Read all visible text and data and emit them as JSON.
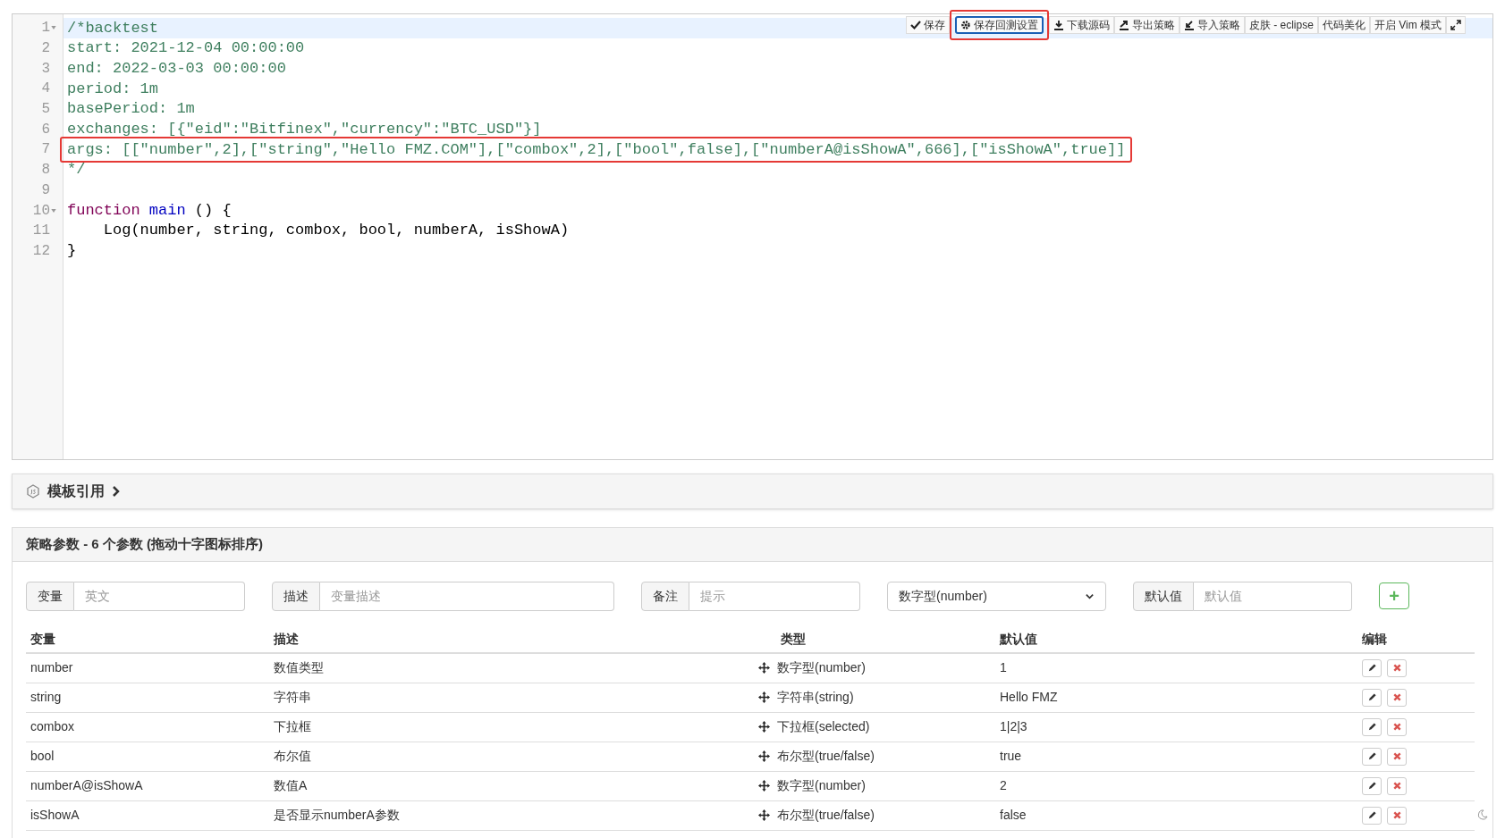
{
  "toolbar": [
    {
      "label": "保存",
      "selected": false,
      "annotated": false
    },
    {
      "label": "保存回测设置",
      "selected": true,
      "annotated": true
    },
    {
      "label": "下载源码",
      "selected": false,
      "annotated": false
    },
    {
      "label": "导出策略",
      "selected": false,
      "annotated": false
    },
    {
      "label": "导入策略",
      "selected": false,
      "annotated": false
    },
    {
      "label": "皮肤 - eclipse",
      "selected": false,
      "annotated": false
    },
    {
      "label": "代码美化",
      "selected": false,
      "annotated": false
    },
    {
      "label": "开启 Vim 模式",
      "selected": false,
      "annotated": false
    },
    {
      "selected": false,
      "annotated": false
    }
  ],
  "editor": {
    "lines": [
      {
        "number": "1",
        "foldable": true,
        "active": true,
        "annotated": false,
        "tokens": [
          {
            "kind": "comment",
            "text": "/*backtest"
          }
        ]
      },
      {
        "number": "2",
        "foldable": false,
        "active": false,
        "annotated": false,
        "tokens": [
          {
            "kind": "comment",
            "text": "start: 2021-12-04 00:00:00"
          }
        ]
      },
      {
        "number": "3",
        "foldable": false,
        "active": false,
        "annotated": false,
        "tokens": [
          {
            "kind": "comment",
            "text": "end: 2022-03-03 00:00:00"
          }
        ]
      },
      {
        "number": "4",
        "foldable": false,
        "active": false,
        "annotated": false,
        "tokens": [
          {
            "kind": "comment",
            "text": "period: 1m"
          }
        ]
      },
      {
        "number": "5",
        "foldable": false,
        "active": false,
        "annotated": false,
        "tokens": [
          {
            "kind": "comment",
            "text": "basePeriod: 1m"
          }
        ]
      },
      {
        "number": "6",
        "foldable": false,
        "active": false,
        "annotated": false,
        "tokens": [
          {
            "kind": "comment",
            "text": "exchanges: [{\"eid\":\"Bitfinex\",\"currency\":\"BTC_USD\"}]"
          }
        ]
      },
      {
        "number": "7",
        "foldable": false,
        "active": false,
        "annotated": true,
        "tokens": [
          {
            "kind": "comment",
            "text": "args: [[\"number\",2],[\"string\",\"Hello FMZ.COM\"],[\"combox\",2],[\"bool\",false],[\"numberA@isShowA\",666],[\"isShowA\",true]]"
          }
        ]
      },
      {
        "number": "8",
        "foldable": false,
        "active": false,
        "annotated": false,
        "tokens": [
          {
            "kind": "comment",
            "text": "*/"
          }
        ]
      },
      {
        "number": "9",
        "foldable": false,
        "active": false,
        "annotated": false
      },
      {
        "number": "10",
        "foldable": true,
        "active": false,
        "annotated": false,
        "tokens": [
          {
            "kind": "keyword",
            "text": "function"
          },
          {
            "kind": "def",
            "text": " main"
          },
          {
            "kind": "plain",
            "text": " () {"
          }
        ]
      },
      {
        "number": "11",
        "foldable": false,
        "active": false,
        "annotated": false,
        "tokens": [
          {
            "kind": "plain",
            "text": "    Log(number, string, combox, bool, numberA, isShowA)"
          }
        ]
      },
      {
        "number": "12",
        "foldable": false,
        "active": false,
        "annotated": false,
        "tokens": [
          {
            "kind": "plain",
            "text": "}"
          }
        ]
      }
    ]
  },
  "template_section": {
    "title": "模板引用"
  },
  "params": {
    "title": "策略参数 - 6 个参数 (拖动十字图标排序)",
    "form": {
      "variable": {
        "label": "变量",
        "placeholder": "英文"
      },
      "description": {
        "label": "描述",
        "placeholder": "变量描述"
      },
      "note": {
        "label": "备注",
        "placeholder": "提示"
      },
      "type": {
        "value": "数字型(number)"
      },
      "default": {
        "label": "默认值",
        "placeholder": "默认值"
      },
      "add_button": "+"
    },
    "columns": [
      "变量",
      "描述",
      "类型",
      "默认值",
      "编辑"
    ],
    "rows": [
      {
        "variable": "number",
        "description": "数值类型",
        "type": "数字型(number)",
        "default": "1"
      },
      {
        "variable": "string",
        "description": "字符串",
        "type": "字符串(string)",
        "default": "Hello FMZ"
      },
      {
        "variable": "combox",
        "description": "下拉框",
        "type": "下拉框(selected)",
        "default": "1|2|3"
      },
      {
        "variable": "bool",
        "description": "布尔值",
        "type": "布尔型(true/false)",
        "default": "true"
      },
      {
        "variable": "numberA@isShowA",
        "description": "数值A",
        "type": "数字型(number)",
        "default": "2"
      },
      {
        "variable": "isShowA",
        "description": "是否显示numberA参数",
        "type": "布尔型(true/false)",
        "default": "false"
      }
    ]
  }
}
